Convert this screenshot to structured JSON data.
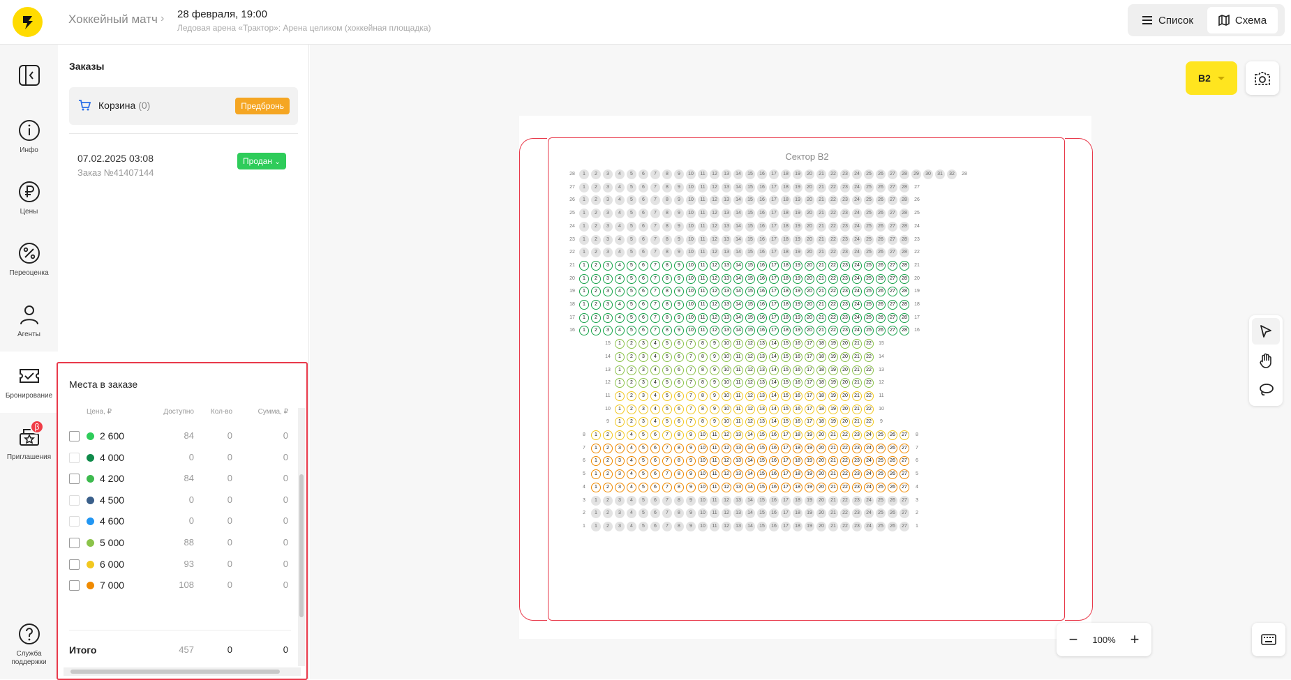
{
  "header": {
    "event_title": "Хоккейный матч",
    "event_date": "28 февраля, 19:00",
    "venue": "Ледовая арена «Трактор»: Арена целиком (хоккейная площадка)",
    "view_list": "Список",
    "view_scheme": "Схема",
    "active_view": "scheme"
  },
  "rail": {
    "items": [
      {
        "label": "",
        "icon": "collapse-panel-icon"
      },
      {
        "label": "Инфо",
        "icon": "info-icon"
      },
      {
        "label": "Цены",
        "icon": "ruble-icon"
      },
      {
        "label": "Переоценка",
        "icon": "percent-icon"
      },
      {
        "label": "Агенты",
        "icon": "person-icon"
      },
      {
        "label": "Бронирование",
        "icon": "ticket-icon"
      },
      {
        "label": "Приглашения",
        "icon": "invite-icon",
        "badge": "β"
      },
      {
        "label": "Служба поддержки",
        "icon": "help-icon"
      }
    ]
  },
  "orders": {
    "title": "Заказы",
    "cart_label": "Корзина",
    "cart_count": "(0)",
    "prebook_label": "Предбронь",
    "order": {
      "date": "07.02.2025 03:08",
      "number": "Заказ №41407144",
      "status": "Продан"
    }
  },
  "seats": {
    "title": "Места в заказе",
    "columns": [
      "Цена, ₽",
      "Доступно",
      "Кол-во",
      "Сумма, ₽"
    ],
    "rows": [
      {
        "price": "2 600",
        "color": "#2ecc5a",
        "available": "84",
        "qty": "0",
        "sum": "0",
        "enabled": true
      },
      {
        "price": "4 000",
        "color": "#0f8a4a",
        "available": "0",
        "qty": "0",
        "sum": "0",
        "enabled": false
      },
      {
        "price": "4 200",
        "color": "#3dba4e",
        "available": "84",
        "qty": "0",
        "sum": "0",
        "enabled": true
      },
      {
        "price": "4 500",
        "color": "#3a5f8a",
        "available": "0",
        "qty": "0",
        "sum": "0",
        "enabled": false
      },
      {
        "price": "4 600",
        "color": "#2196f3",
        "available": "0",
        "qty": "0",
        "sum": "0",
        "enabled": false
      },
      {
        "price": "5 000",
        "color": "#8bc34a",
        "available": "88",
        "qty": "0",
        "sum": "0",
        "enabled": true
      },
      {
        "price": "6 000",
        "color": "#f2c81f",
        "available": "93",
        "qty": "0",
        "sum": "0",
        "enabled": true
      },
      {
        "price": "7 000",
        "color": "#f08a00",
        "available": "108",
        "qty": "0",
        "sum": "0",
        "enabled": true
      }
    ],
    "total_label": "Итого",
    "total_available": "457",
    "total_qty": "0",
    "total_sum": "0"
  },
  "canvas": {
    "sector_button": "B2",
    "sector_title": "Сектор B2",
    "zoom": "100%"
  },
  "seat_map": {
    "rows": [
      {
        "row": 28,
        "seats": 32,
        "category": "grey"
      },
      {
        "row": 27,
        "seats": 28,
        "category": "grey"
      },
      {
        "row": 26,
        "seats": 28,
        "category": "grey"
      },
      {
        "row": 25,
        "seats": 28,
        "category": "grey"
      },
      {
        "row": 24,
        "seats": 28,
        "category": "grey"
      },
      {
        "row": 23,
        "seats": 28,
        "category": "grey"
      },
      {
        "row": 22,
        "seats": 28,
        "category": "grey"
      },
      {
        "row": 21,
        "seats": 28,
        "category": "green"
      },
      {
        "row": 20,
        "seats": 28,
        "category": "green"
      },
      {
        "row": 19,
        "seats": 28,
        "category": "green"
      },
      {
        "row": 18,
        "seats": 28,
        "category": "green"
      },
      {
        "row": 17,
        "seats": 28,
        "category": "green"
      },
      {
        "row": 16,
        "seats": 28,
        "category": "green"
      },
      {
        "row": 15,
        "seats": 22,
        "category": "lgreen"
      },
      {
        "row": 14,
        "seats": 22,
        "category": "lgreen"
      },
      {
        "row": 13,
        "seats": 22,
        "category": "lgreen"
      },
      {
        "row": 12,
        "seats": 22,
        "category": "lgreen"
      },
      {
        "row": 11,
        "seats": 22,
        "category": "yellow"
      },
      {
        "row": 10,
        "seats": 22,
        "category": "yellow"
      },
      {
        "row": 9,
        "seats": 22,
        "category": "yellow"
      },
      {
        "row": 8,
        "seats": 27,
        "category": "yellow"
      },
      {
        "row": 7,
        "seats": 27,
        "category": "orange"
      },
      {
        "row": 6,
        "seats": 27,
        "category": "orange"
      },
      {
        "row": 5,
        "seats": 27,
        "category": "orange"
      },
      {
        "row": 4,
        "seats": 27,
        "category": "orange"
      },
      {
        "row": 3,
        "seats": 27,
        "category": "grey"
      },
      {
        "row": 2,
        "seats": 27,
        "category": "grey"
      },
      {
        "row": 1,
        "seats": 27,
        "category": "grey"
      }
    ]
  }
}
